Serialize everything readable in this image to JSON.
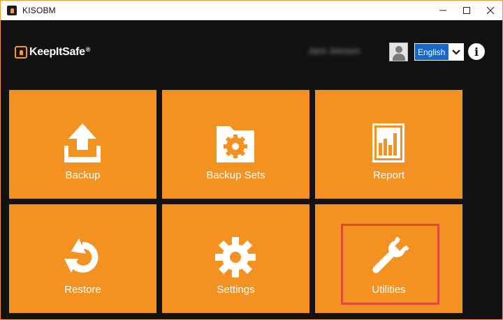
{
  "window": {
    "title": "KISOBM",
    "controls": [
      "minimize-icon",
      "maximize-icon",
      "close-icon"
    ]
  },
  "header": {
    "logo_text": "KeepItSafe",
    "logo_tm": "®",
    "username": "Jane Johnson",
    "language": {
      "selected": "English"
    },
    "info_icon": "info-icon"
  },
  "tiles": [
    {
      "label": "Backup",
      "icon": "upload-icon"
    },
    {
      "label": "Backup Sets",
      "icon": "folder-gear-icon"
    },
    {
      "label": "Report",
      "icon": "report-chart-icon"
    },
    {
      "label": "Restore",
      "icon": "restore-icon"
    },
    {
      "label": "Settings",
      "icon": "gear-icon"
    },
    {
      "label": "Utilities",
      "icon": "wrench-icon"
    }
  ],
  "colors": {
    "tile": "#f39220",
    "background": "#121212",
    "highlight": "#e2483a",
    "language_bg": "#1668c9"
  }
}
